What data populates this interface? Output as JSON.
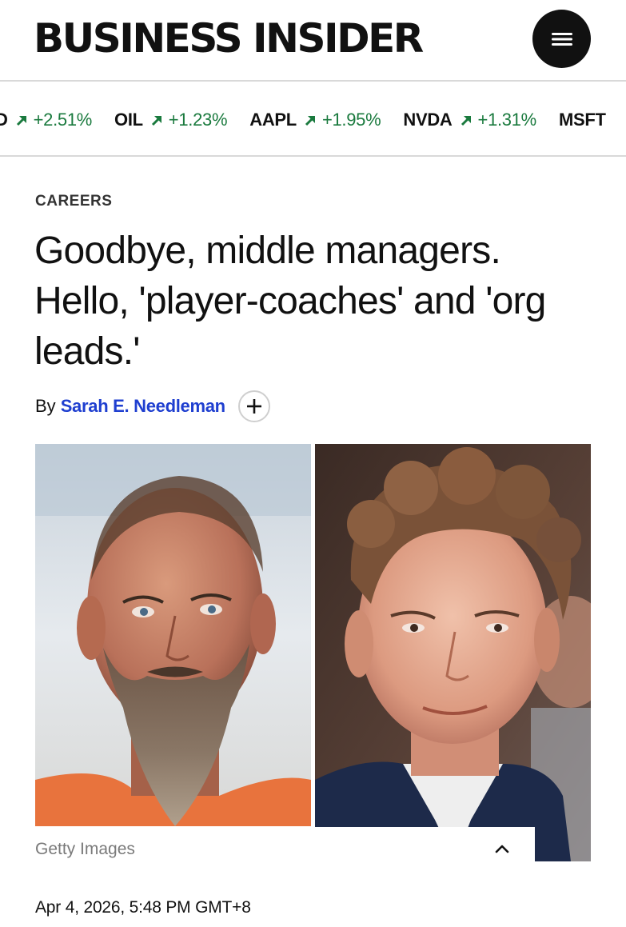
{
  "header": {
    "logo": "BUSINESS INSIDER",
    "menu_icon": "hamburger-menu-icon"
  },
  "ticker": [
    {
      "symbol": "D",
      "change": "+2.51%",
      "direction": "up"
    },
    {
      "symbol": "OIL",
      "change": "+1.23%",
      "direction": "up"
    },
    {
      "symbol": "AAPL",
      "change": "+1.95%",
      "direction": "up"
    },
    {
      "symbol": "NVDA",
      "change": "+1.31%",
      "direction": "up"
    },
    {
      "symbol": "MSFT",
      "change": "",
      "direction": "up"
    }
  ],
  "article": {
    "category": "CAREERS",
    "headline": "Goodbye, middle managers. Hello, 'player-coaches' and 'org leads.'",
    "byline_prefix": "By",
    "author": "Sarah E. Needleman",
    "follow_icon": "plus-icon",
    "image_caption": "Getty Images",
    "collapse_icon": "chevron-up-icon",
    "date": "Apr 4, 2026, 5:48 PM GMT+8"
  },
  "colors": {
    "positive": "#1a7a3e",
    "author_link": "#1f3fd0",
    "text": "#111111",
    "caption": "#7a7a7a",
    "divider": "#d9d9d9"
  }
}
